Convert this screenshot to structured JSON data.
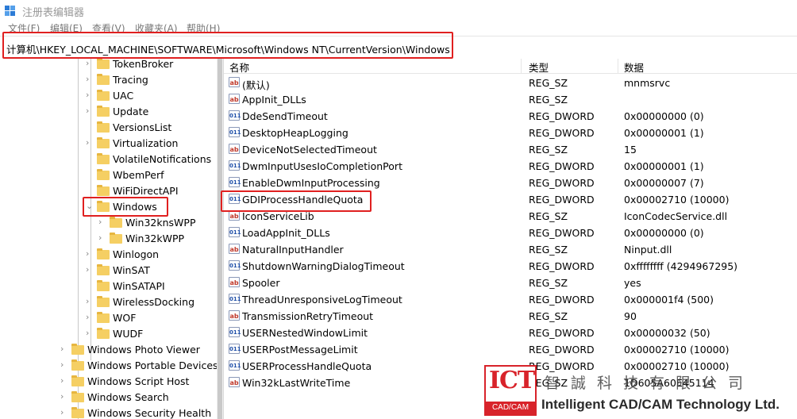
{
  "window": {
    "title": "注册表编辑器"
  },
  "menu": [
    "文件(F)",
    "编辑(E)",
    "查看(V)",
    "收藏夹(A)",
    "帮助(H)"
  ],
  "address": "计算机\\HKEY_LOCAL_MACHINE\\SOFTWARE\\Microsoft\\Windows NT\\CurrentVersion\\Windows",
  "tree": [
    {
      "label": "TokenBroker",
      "expander": "›"
    },
    {
      "label": "Tracing",
      "expander": "›"
    },
    {
      "label": "UAC",
      "expander": "›"
    },
    {
      "label": "Update",
      "expander": "›"
    },
    {
      "label": "VersionsList",
      "expander": ""
    },
    {
      "label": "Virtualization",
      "expander": "›"
    },
    {
      "label": "VolatileNotifications",
      "expander": ""
    },
    {
      "label": "WbemPerf",
      "expander": ""
    },
    {
      "label": "WiFiDirectAPI",
      "expander": ""
    },
    {
      "label": "Windows",
      "expander": "⌄",
      "selected": true
    },
    {
      "label": "Win32knsWPP",
      "expander": "›"
    },
    {
      "label": "Win32kWPP",
      "expander": "›"
    },
    {
      "label": "Winlogon",
      "expander": "›"
    },
    {
      "label": "WinSAT",
      "expander": "›"
    },
    {
      "label": "WinSATAPI",
      "expander": ""
    },
    {
      "label": "WirelessDocking",
      "expander": "›"
    },
    {
      "label": "WOF",
      "expander": "›"
    },
    {
      "label": "WUDF",
      "expander": "›"
    },
    {
      "label": "Windows Photo Viewer",
      "expander": "›"
    },
    {
      "label": "Windows Portable Devices",
      "expander": "›"
    },
    {
      "label": "Windows Script Host",
      "expander": "›"
    },
    {
      "label": "Windows Search",
      "expander": "›"
    },
    {
      "label": "Windows Security Health",
      "expander": "›"
    }
  ],
  "columns": {
    "name": "名称",
    "type": "类型",
    "data": "数据"
  },
  "values": [
    {
      "name": "(默认)",
      "type": "REG_SZ",
      "data": "mnmsrvc",
      "icon": "ab"
    },
    {
      "name": "AppInit_DLLs",
      "type": "REG_SZ",
      "data": "",
      "icon": "ab"
    },
    {
      "name": "DdeSendTimeout",
      "type": "REG_DWORD",
      "data": "0x00000000 (0)",
      "icon": "011"
    },
    {
      "name": "DesktopHeapLogging",
      "type": "REG_DWORD",
      "data": "0x00000001 (1)",
      "icon": "011"
    },
    {
      "name": "DeviceNotSelectedTimeout",
      "type": "REG_SZ",
      "data": "15",
      "icon": "ab"
    },
    {
      "name": "DwmInputUsesIoCompletionPort",
      "type": "REG_DWORD",
      "data": "0x00000001 (1)",
      "icon": "011"
    },
    {
      "name": "EnableDwmInputProcessing",
      "type": "REG_DWORD",
      "data": "0x00000007 (7)",
      "icon": "011"
    },
    {
      "name": "GDIProcessHandleQuota",
      "type": "REG_DWORD",
      "data": "0x00002710 (10000)",
      "icon": "011"
    },
    {
      "name": "IconServiceLib",
      "type": "REG_SZ",
      "data": "IconCodecService.dll",
      "icon": "ab"
    },
    {
      "name": "LoadAppInit_DLLs",
      "type": "REG_DWORD",
      "data": "0x00000000 (0)",
      "icon": "011"
    },
    {
      "name": "NaturalInputHandler",
      "type": "REG_SZ",
      "data": "Ninput.dll",
      "icon": "ab"
    },
    {
      "name": "ShutdownWarningDialogTimeout",
      "type": "REG_DWORD",
      "data": "0xffffffff (4294967295)",
      "icon": "011"
    },
    {
      "name": "Spooler",
      "type": "REG_SZ",
      "data": "yes",
      "icon": "ab"
    },
    {
      "name": "ThreadUnresponsiveLogTimeout",
      "type": "REG_DWORD",
      "data": "0x000001f4 (500)",
      "icon": "011"
    },
    {
      "name": "TransmissionRetryTimeout",
      "type": "REG_SZ",
      "data": "90",
      "icon": "ab"
    },
    {
      "name": "USERNestedWindowLimit",
      "type": "REG_DWORD",
      "data": "0x00000032 (50)",
      "icon": "011"
    },
    {
      "name": "USERPostMessageLimit",
      "type": "REG_DWORD",
      "data": "0x00002710 (10000)",
      "icon": "011"
    },
    {
      "name": "USERProcessHandleQuota",
      "type": "REG_DWORD",
      "data": "0x00002710 (10000)",
      "icon": "011"
    },
    {
      "name": "Win32kLastWriteTime",
      "type": "REG_SZ",
      "data": "1D605A60E45114",
      "icon": "ab"
    }
  ],
  "watermark": {
    "logo_text": "ICT",
    "logo_sub": "CAD/CAM",
    "company_cn": "智誠科技有限公司",
    "company_en": "Intelligent CAD/CAM Technology Ltd."
  },
  "colors": {
    "highlight": "#e02020",
    "brand": "#d8232a",
    "folder": "#f5cf63"
  }
}
